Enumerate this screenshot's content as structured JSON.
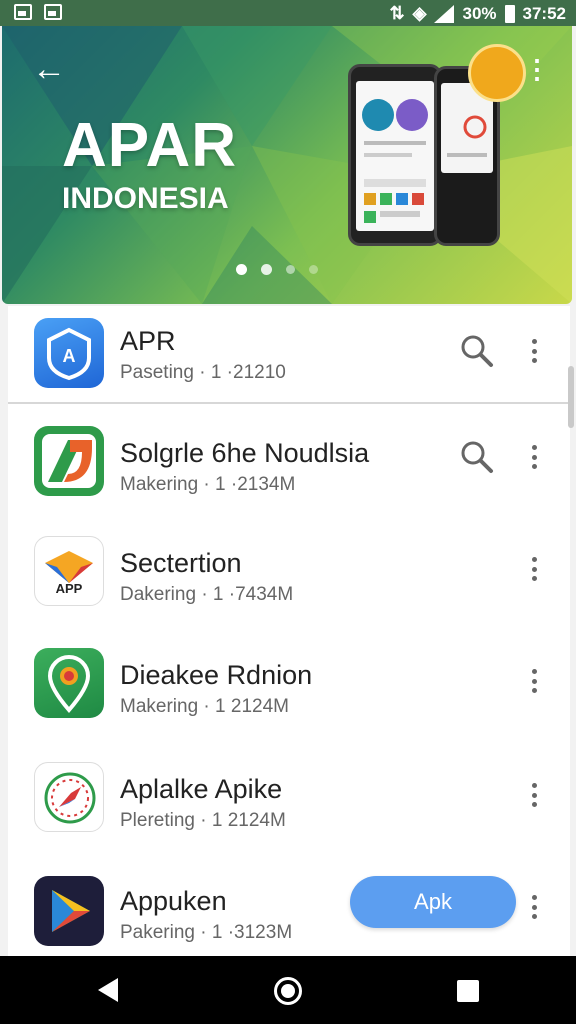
{
  "status_bar": {
    "battery": "30%",
    "time": "37:52"
  },
  "banner": {
    "logo_word": "APAR",
    "logo_subtitle": "INDONESIA",
    "page_dots": 4,
    "active_dot": 0
  },
  "apps": [
    {
      "name": "APR",
      "meta": "Paseting · 1 ·21210",
      "has_search": true
    },
    {
      "name": "Solgrle 6he Noudlsia",
      "meta": "Makering · 1 ·2134M",
      "has_search": true
    },
    {
      "name": "Sectertion",
      "meta": "Dakering · 1 ·7434M"
    },
    {
      "name": "Dieakee Rdnion",
      "meta": "Makering · 1  2124M"
    },
    {
      "name": "Aplalke Apike",
      "meta": "Plereting · 1  2124M"
    },
    {
      "name": "Appuken",
      "meta": "Pakering · 1 ·3123M",
      "action_label": "Apk"
    }
  ],
  "colors": {
    "accent": "#5c9ef0",
    "status_bar": "#3f6e4a",
    "nav_bar": "#000000"
  },
  "icons": [
    "back-arrow-icon",
    "more-vert-icon",
    "search-icon",
    "nav-back-icon",
    "nav-home-icon",
    "nav-recents-icon"
  ]
}
